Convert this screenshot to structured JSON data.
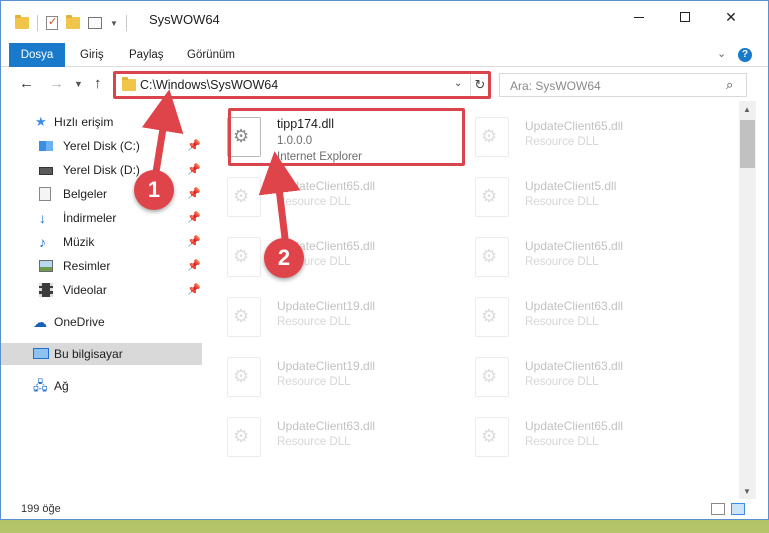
{
  "window": {
    "title": "SysWOW64",
    "controls": {
      "minimize": "minimize",
      "maximize": "maximize",
      "close": "✕"
    }
  },
  "ribbon": {
    "tabs": [
      {
        "label": "Dosya"
      },
      {
        "label": "Giriş"
      },
      {
        "label": "Paylaş"
      },
      {
        "label": "Görünüm"
      }
    ],
    "help": "?"
  },
  "nav": {
    "address": "C:\\Windows\\SysWOW64",
    "search_placeholder": "Ara: SysWOW64"
  },
  "sidebar": {
    "items": [
      {
        "label": "Hızlı erişim",
        "icon": "star-icon"
      },
      {
        "label": "Yerel Disk (C:)",
        "icon": "drive-icon"
      },
      {
        "label": "Yerel Disk (D:)",
        "icon": "drive-icon"
      },
      {
        "label": "Belgeler",
        "icon": "documents-icon"
      },
      {
        "label": "İndirmeler",
        "icon": "downloads-icon"
      },
      {
        "label": "Müzik",
        "icon": "music-icon"
      },
      {
        "label": "Resimler",
        "icon": "pictures-icon"
      },
      {
        "label": "Videolar",
        "icon": "videos-icon"
      },
      {
        "label": "OneDrive",
        "icon": "onedrive-icon"
      },
      {
        "label": "Bu bilgisayar",
        "icon": "computer-icon"
      },
      {
        "label": "Ağ",
        "icon": "network-icon"
      }
    ]
  },
  "files": [
    {
      "name": "tipp174.dll",
      "version": "1.0.0.0",
      "company": "Internet Explorer"
    },
    {
      "name": "UpdateClient65.dll",
      "type": "Resource DLL"
    },
    {
      "name": "UpdateClient65.dll",
      "type": "Resource DLL"
    },
    {
      "name": "UpdateClient5.dll",
      "type": "Resource DLL"
    },
    {
      "name": "UpdateClient65.dll",
      "type": "Resource DLL"
    },
    {
      "name": "UpdateClient65.dll",
      "type": "Resource DLL"
    },
    {
      "name": "UpdateClient19.dll",
      "type": "Resource DLL"
    },
    {
      "name": "UpdateClient63.dll",
      "type": "Resource DLL"
    },
    {
      "name": "UpdateClient19.dll",
      "type": "Resource DLL"
    },
    {
      "name": "UpdateClient63.dll",
      "type": "Resource DLL"
    },
    {
      "name": "UpdateClient63.dll",
      "type": "Resource DLL"
    },
    {
      "name": "UpdateClient65.dll",
      "type": "Resource DLL"
    }
  ],
  "status": {
    "count": "199 öğe"
  },
  "callouts": [
    "1",
    "2"
  ],
  "colors": {
    "accent": "#1979ca",
    "highlight": "#d9454a"
  }
}
